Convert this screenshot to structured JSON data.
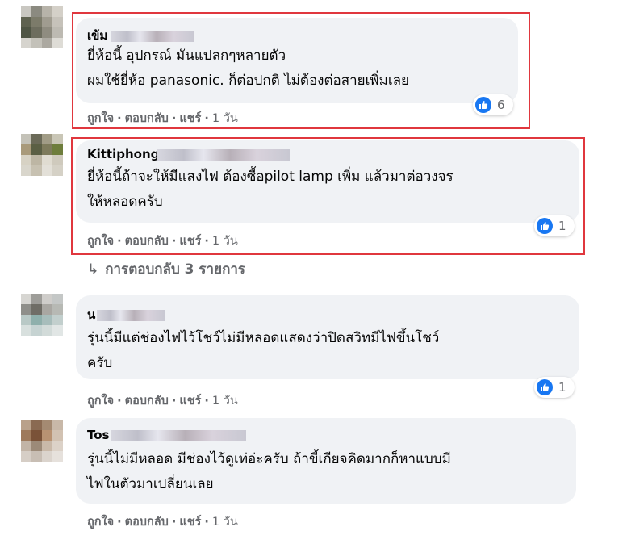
{
  "comments": [
    {
      "name": "เข้ม",
      "lines": [
        "ยี่ห้อนี้ อุปกรณ์ มันแปลกๆหลายตัว",
        "ผมใช้ยี่ห้อ panasonic. ก็ต่อปกติ ไม่ต้องต่อสายเพิ่มเลย"
      ],
      "like_label": "ถูกใจ",
      "reply_label": "ตอบกลับ",
      "share_label": "แชร์",
      "time": "1 วัน",
      "reaction_count": "6"
    },
    {
      "name": "Kittiphong",
      "lines": [
        "ยี่ห้อนี้ถ้าจะให้มีแสงไฟ ต้องซื้อpilot lamp เพิ่ม แล้วมาต่อวงจร",
        "ให้หลอดครับ"
      ],
      "like_label": "ถูกใจ",
      "reply_label": "ตอบกลับ",
      "share_label": "แชร์",
      "time": "1 วัน",
      "reaction_count": "1"
    },
    {
      "name": "น",
      "lines": [
        "รุ่นนี้มีแต่ช่องไฟไว้โชว์ไม่มีหลอดแสดงว่าปิดสวิทมีไฟขึ้นโชว์",
        "ครับ"
      ],
      "like_label": "ถูกใจ",
      "reply_label": "ตอบกลับ",
      "share_label": "แชร์",
      "time": "1 วัน",
      "reaction_count": "1"
    },
    {
      "name": "Tos",
      "lines": [
        "รุ่นนี้ไม่มีหลอด มีช่องไว้ดูเท่อ่ะครับ ถ้าขี้เกียจคิดมากก็หาแบบมี",
        "ไฟในตัวมาเปลี่ยนเลย"
      ],
      "like_label": "ถูกใจ",
      "reply_label": "ตอบกลับ",
      "share_label": "แชร์",
      "time": "1 วัน"
    }
  ],
  "view_replies": "การตอบกลับ 3 รายการ",
  "icons": {
    "reaction": "like-thumb-icon",
    "replies": "reply-arrow-icon"
  },
  "colors": {
    "bubble": "#f0f2f5",
    "meta": "#65676b",
    "like_blue": "#1877f2",
    "highlight": "#e0373e"
  }
}
